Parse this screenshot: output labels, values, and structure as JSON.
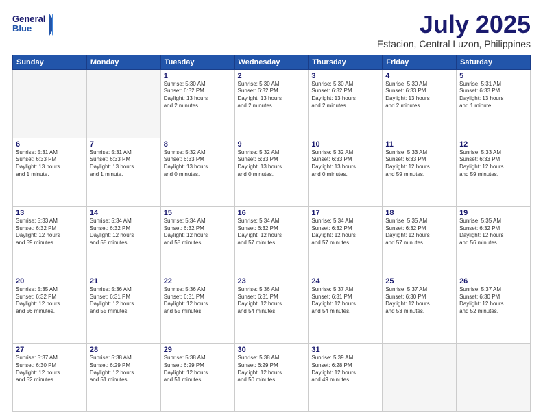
{
  "header": {
    "logo_line1": "General",
    "logo_line2": "Blue",
    "month": "July 2025",
    "location": "Estacion, Central Luzon, Philippines"
  },
  "days_of_week": [
    "Sunday",
    "Monday",
    "Tuesday",
    "Wednesday",
    "Thursday",
    "Friday",
    "Saturday"
  ],
  "weeks": [
    [
      {
        "day": "",
        "text": ""
      },
      {
        "day": "",
        "text": ""
      },
      {
        "day": "1",
        "text": "Sunrise: 5:30 AM\nSunset: 6:32 PM\nDaylight: 13 hours\nand 2 minutes."
      },
      {
        "day": "2",
        "text": "Sunrise: 5:30 AM\nSunset: 6:32 PM\nDaylight: 13 hours\nand 2 minutes."
      },
      {
        "day": "3",
        "text": "Sunrise: 5:30 AM\nSunset: 6:32 PM\nDaylight: 13 hours\nand 2 minutes."
      },
      {
        "day": "4",
        "text": "Sunrise: 5:30 AM\nSunset: 6:33 PM\nDaylight: 13 hours\nand 2 minutes."
      },
      {
        "day": "5",
        "text": "Sunrise: 5:31 AM\nSunset: 6:33 PM\nDaylight: 13 hours\nand 1 minute."
      }
    ],
    [
      {
        "day": "6",
        "text": "Sunrise: 5:31 AM\nSunset: 6:33 PM\nDaylight: 13 hours\nand 1 minute."
      },
      {
        "day": "7",
        "text": "Sunrise: 5:31 AM\nSunset: 6:33 PM\nDaylight: 13 hours\nand 1 minute."
      },
      {
        "day": "8",
        "text": "Sunrise: 5:32 AM\nSunset: 6:33 PM\nDaylight: 13 hours\nand 0 minutes."
      },
      {
        "day": "9",
        "text": "Sunrise: 5:32 AM\nSunset: 6:33 PM\nDaylight: 13 hours\nand 0 minutes."
      },
      {
        "day": "10",
        "text": "Sunrise: 5:32 AM\nSunset: 6:33 PM\nDaylight: 13 hours\nand 0 minutes."
      },
      {
        "day": "11",
        "text": "Sunrise: 5:33 AM\nSunset: 6:33 PM\nDaylight: 12 hours\nand 59 minutes."
      },
      {
        "day": "12",
        "text": "Sunrise: 5:33 AM\nSunset: 6:33 PM\nDaylight: 12 hours\nand 59 minutes."
      }
    ],
    [
      {
        "day": "13",
        "text": "Sunrise: 5:33 AM\nSunset: 6:32 PM\nDaylight: 12 hours\nand 59 minutes."
      },
      {
        "day": "14",
        "text": "Sunrise: 5:34 AM\nSunset: 6:32 PM\nDaylight: 12 hours\nand 58 minutes."
      },
      {
        "day": "15",
        "text": "Sunrise: 5:34 AM\nSunset: 6:32 PM\nDaylight: 12 hours\nand 58 minutes."
      },
      {
        "day": "16",
        "text": "Sunrise: 5:34 AM\nSunset: 6:32 PM\nDaylight: 12 hours\nand 57 minutes."
      },
      {
        "day": "17",
        "text": "Sunrise: 5:34 AM\nSunset: 6:32 PM\nDaylight: 12 hours\nand 57 minutes."
      },
      {
        "day": "18",
        "text": "Sunrise: 5:35 AM\nSunset: 6:32 PM\nDaylight: 12 hours\nand 57 minutes."
      },
      {
        "day": "19",
        "text": "Sunrise: 5:35 AM\nSunset: 6:32 PM\nDaylight: 12 hours\nand 56 minutes."
      }
    ],
    [
      {
        "day": "20",
        "text": "Sunrise: 5:35 AM\nSunset: 6:32 PM\nDaylight: 12 hours\nand 56 minutes."
      },
      {
        "day": "21",
        "text": "Sunrise: 5:36 AM\nSunset: 6:31 PM\nDaylight: 12 hours\nand 55 minutes."
      },
      {
        "day": "22",
        "text": "Sunrise: 5:36 AM\nSunset: 6:31 PM\nDaylight: 12 hours\nand 55 minutes."
      },
      {
        "day": "23",
        "text": "Sunrise: 5:36 AM\nSunset: 6:31 PM\nDaylight: 12 hours\nand 54 minutes."
      },
      {
        "day": "24",
        "text": "Sunrise: 5:37 AM\nSunset: 6:31 PM\nDaylight: 12 hours\nand 54 minutes."
      },
      {
        "day": "25",
        "text": "Sunrise: 5:37 AM\nSunset: 6:30 PM\nDaylight: 12 hours\nand 53 minutes."
      },
      {
        "day": "26",
        "text": "Sunrise: 5:37 AM\nSunset: 6:30 PM\nDaylight: 12 hours\nand 52 minutes."
      }
    ],
    [
      {
        "day": "27",
        "text": "Sunrise: 5:37 AM\nSunset: 6:30 PM\nDaylight: 12 hours\nand 52 minutes."
      },
      {
        "day": "28",
        "text": "Sunrise: 5:38 AM\nSunset: 6:29 PM\nDaylight: 12 hours\nand 51 minutes."
      },
      {
        "day": "29",
        "text": "Sunrise: 5:38 AM\nSunset: 6:29 PM\nDaylight: 12 hours\nand 51 minutes."
      },
      {
        "day": "30",
        "text": "Sunrise: 5:38 AM\nSunset: 6:29 PM\nDaylight: 12 hours\nand 50 minutes."
      },
      {
        "day": "31",
        "text": "Sunrise: 5:39 AM\nSunset: 6:28 PM\nDaylight: 12 hours\nand 49 minutes."
      },
      {
        "day": "",
        "text": ""
      },
      {
        "day": "",
        "text": ""
      }
    ]
  ]
}
